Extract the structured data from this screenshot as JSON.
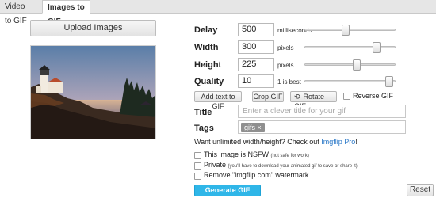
{
  "tabs": [
    "Video to GIF",
    "Images to GIF"
  ],
  "upload": {
    "label": "Upload Images"
  },
  "settings": {
    "delay": {
      "label": "Delay",
      "value": "500",
      "unit": "milliseconds",
      "slider_fraction": 0.45
    },
    "width": {
      "label": "Width",
      "value": "300",
      "unit": "pixels",
      "slider_fraction": 0.82
    },
    "height": {
      "label": "Height",
      "value": "225",
      "unit": "pixels",
      "slider_fraction": 0.58
    },
    "quality": {
      "label": "Quality",
      "value": "10",
      "unit": "1 is best",
      "slider_fraction": 0.97
    }
  },
  "actions": {
    "add_text": "Add text to GIF",
    "crop": "Crop GIF",
    "rotate": "Rotate GIF",
    "reverse": "Reverse GIF"
  },
  "title_field": {
    "label": "Title",
    "placeholder": "Enter a clever title for your gif"
  },
  "tags_field": {
    "label": "Tags",
    "tags": [
      "gifs ×"
    ]
  },
  "promo": {
    "text": "Want unlimited width/height? Check out",
    "link": "Imgflip Pro",
    "suffix": "!"
  },
  "options": {
    "nsfw": {
      "label": "This image is NSFW",
      "note": "(not safe for work)"
    },
    "private": {
      "label": "Private",
      "note": "(you'll have to download your animated gif to save or share it)"
    },
    "watermark": {
      "label": "Remove \"imgflip.com\" watermark"
    }
  },
  "buttons": {
    "generate": "Generate GIF",
    "reset": "Reset"
  },
  "icons": {
    "rotate": "rotate-icon"
  },
  "colors": {
    "accent": "#2fb6e8",
    "link": "#2a78c8"
  }
}
